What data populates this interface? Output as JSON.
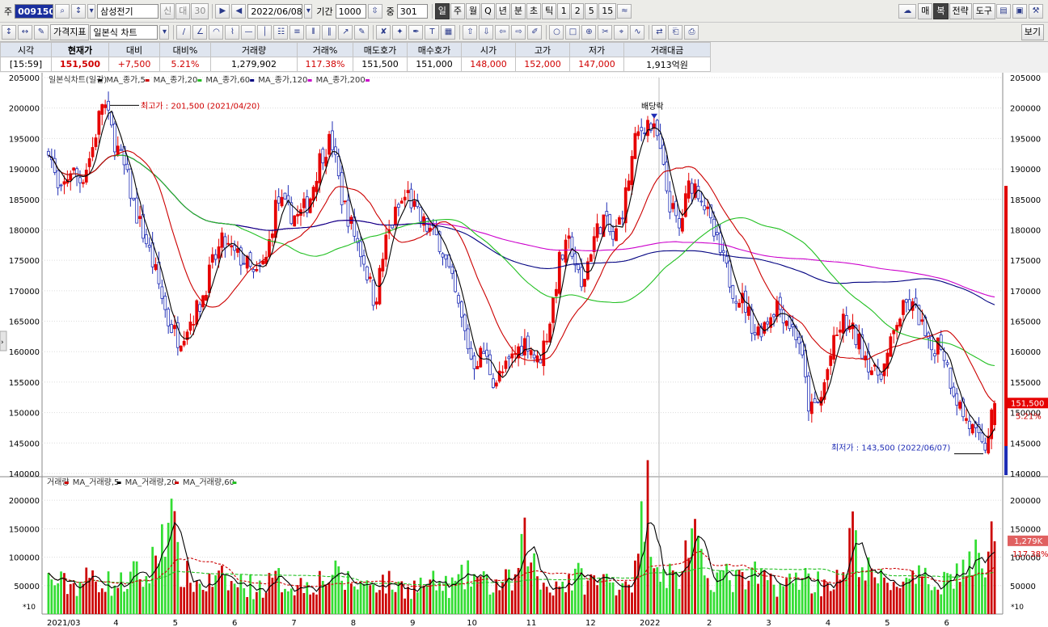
{
  "toolbar1": {
    "code_label": "주",
    "stock_code": "009150",
    "stock_name": "삼성전기",
    "tag_new": "신",
    "tag_mini": "대",
    "tag_num": "30",
    "date": "2022/06/08",
    "period_label": "기간",
    "period_value": "1000",
    "count_label": "중",
    "count_value": "301",
    "intervals": [
      "일",
      "주",
      "월",
      "Q",
      "년",
      "분",
      "초",
      "틱",
      "1",
      "2",
      "5",
      "15"
    ],
    "right_buttons": [
      "매",
      "복",
      "전략",
      "도구"
    ]
  },
  "toolbar2": {
    "indicator_button": "가격지표",
    "chart_type": "일본식 차트",
    "view_button": "보기"
  },
  "quote": {
    "headers": [
      "시각",
      "현재가",
      "대비",
      "대비%",
      "거래량",
      "거래%",
      "매도호가",
      "매수호가",
      "시가",
      "고가",
      "저가",
      "거래대금"
    ],
    "values": [
      "[15:59]",
      "151,500",
      "+7,500",
      "5.21%",
      "1,279,902",
      "117.38%",
      "151,500",
      "151,000",
      "148,000",
      "152,000",
      "147,000",
      "1,913억원"
    ]
  },
  "colors": {
    "up": "#e60000",
    "down": "#1f2db5",
    "ma5": "#000000",
    "ma20": "#cc0000",
    "ma60": "#22c022",
    "ma120": "#000080",
    "ma200": "#cc00cc",
    "vol_up": "#cc0000",
    "vol_down": "#33dd33",
    "vma5": "#000000",
    "vma20": "#cc0000",
    "vma60": "#22c022"
  },
  "chart_data": {
    "type": "candlestick",
    "price_legend": [
      "일본식차트(일간)",
      "MA_종가,5",
      "MA_종가,20",
      "MA_종가,60",
      "MA_종가,120",
      "MA_종가,200"
    ],
    "volume_legend": [
      "거래량",
      "MA_거래량,5",
      "MA_거래량,20",
      "MA_거래량,60"
    ],
    "price_ylim": [
      140000,
      205000
    ],
    "price_ticks": [
      140000,
      145000,
      150000,
      155000,
      160000,
      165000,
      170000,
      175000,
      180000,
      185000,
      190000,
      195000,
      200000,
      205000
    ],
    "volume_ylim": [
      0,
      230000
    ],
    "volume_ticks": [
      50000,
      100000,
      150000,
      200000
    ],
    "volume_unit": "*10",
    "x_labels": [
      "2021/03",
      "4",
      "5",
      "6",
      "7",
      "8",
      "9",
      "10",
      "11",
      "12",
      "2022",
      "2",
      "3",
      "4",
      "5",
      "6"
    ],
    "anchors": {
      "prices": [
        194000,
        185000,
        190000,
        188000,
        193000,
        201500,
        195000,
        190000,
        183000,
        178000,
        172000,
        165000,
        162000,
        165000,
        168000,
        174000,
        178000,
        176000,
        175000,
        172000,
        175000,
        185000,
        183000,
        182000,
        185000,
        192000,
        195000,
        185000,
        180000,
        175000,
        168000,
        178000,
        183000,
        186000,
        182000,
        180000,
        178000,
        172000,
        165000,
        158000,
        160000,
        155000,
        157000,
        160000,
        162000,
        158000,
        164000,
        175000,
        178000,
        170000,
        178000,
        182000,
        178000,
        185000,
        195000,
        198000,
        195000,
        185000,
        180000,
        188000,
        186000,
        180000,
        175000,
        170000,
        168000,
        163000,
        165000,
        168000,
        165000,
        162000,
        150000,
        152000,
        160000,
        165000,
        163000,
        160000,
        156000,
        158000,
        165000,
        168000,
        166000,
        160000,
        162000,
        155000,
        150000,
        147000,
        143500,
        151500
      ],
      "volumes": [
        60000,
        55000,
        50000,
        55000,
        65000,
        60000,
        50000,
        55000,
        70000,
        60000,
        110000,
        200000,
        80000,
        60000,
        50000,
        55000,
        60000,
        50000,
        55000,
        45000,
        50000,
        60000,
        55000,
        50000,
        55000,
        60000,
        70000,
        60000,
        55000,
        50000,
        60000,
        55000,
        50000,
        45000,
        50000,
        55000,
        50000,
        48000,
        60000,
        70000,
        55000,
        50000,
        55000,
        60000,
        140000,
        55000,
        50000,
        55000,
        60000,
        65000,
        55000,
        60000,
        55000,
        60000,
        70000,
        220000,
        90000,
        70000,
        60000,
        150000,
        80000,
        70000,
        65000,
        60000,
        55000,
        65000,
        60000,
        55000,
        50000,
        70000,
        60000,
        55000,
        60000,
        55000,
        140000,
        80000,
        60000,
        55000,
        60000,
        50000,
        60000,
        55000,
        60000,
        65000,
        80000,
        90000,
        100000,
        128000
      ]
    },
    "annotations": {
      "high": "최고가 : 201,500 (2021/04/20)",
      "low": "최저가 : 143,500 (2022/06/07)",
      "dividend": "배당락"
    },
    "last_price_tag": "151,500",
    "last_change_tag": "5.21%",
    "last_volume_tag": "1,279K",
    "last_volume_ratio_tag": "117.38%"
  }
}
